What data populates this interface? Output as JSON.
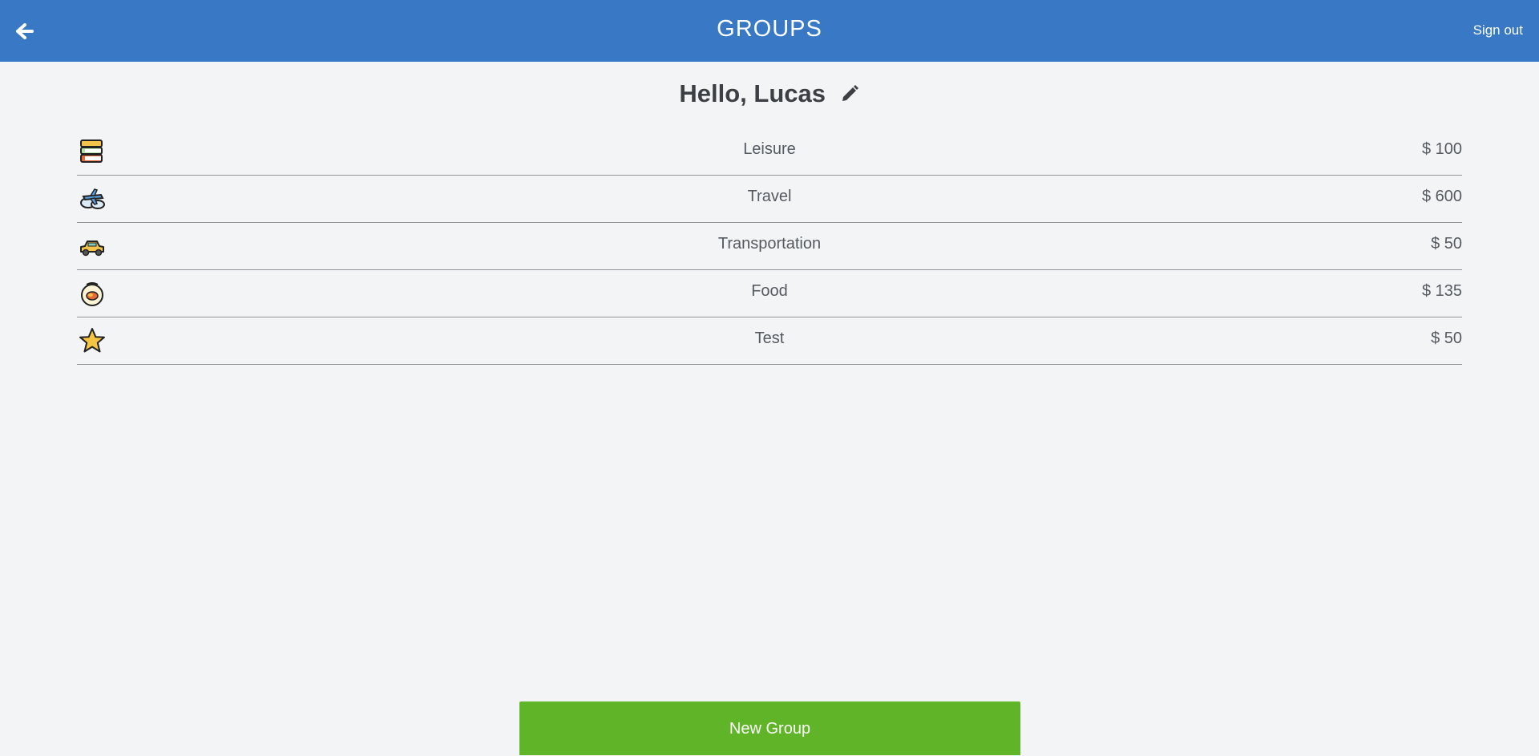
{
  "header": {
    "title": "GROUPS",
    "signout_label": "Sign out",
    "back_icon": "back-arrow-icon",
    "background_color": "#3878c4"
  },
  "greeting": {
    "text": "Hello, Lucas",
    "edit_icon": "pencil-icon"
  },
  "groups": [
    {
      "name": "Leisure",
      "amount": "$ 100",
      "icon": "books-icon"
    },
    {
      "name": "Travel",
      "amount": "$ 600",
      "icon": "airplane-icon"
    },
    {
      "name": "Transportation",
      "amount": "$ 50",
      "icon": "taxi-icon"
    },
    {
      "name": "Food",
      "amount": "$ 135",
      "icon": "food-icon"
    },
    {
      "name": "Test",
      "amount": "$ 50",
      "icon": "star-icon"
    }
  ],
  "new_group": {
    "label": "New Group",
    "color": "#5fb427"
  }
}
